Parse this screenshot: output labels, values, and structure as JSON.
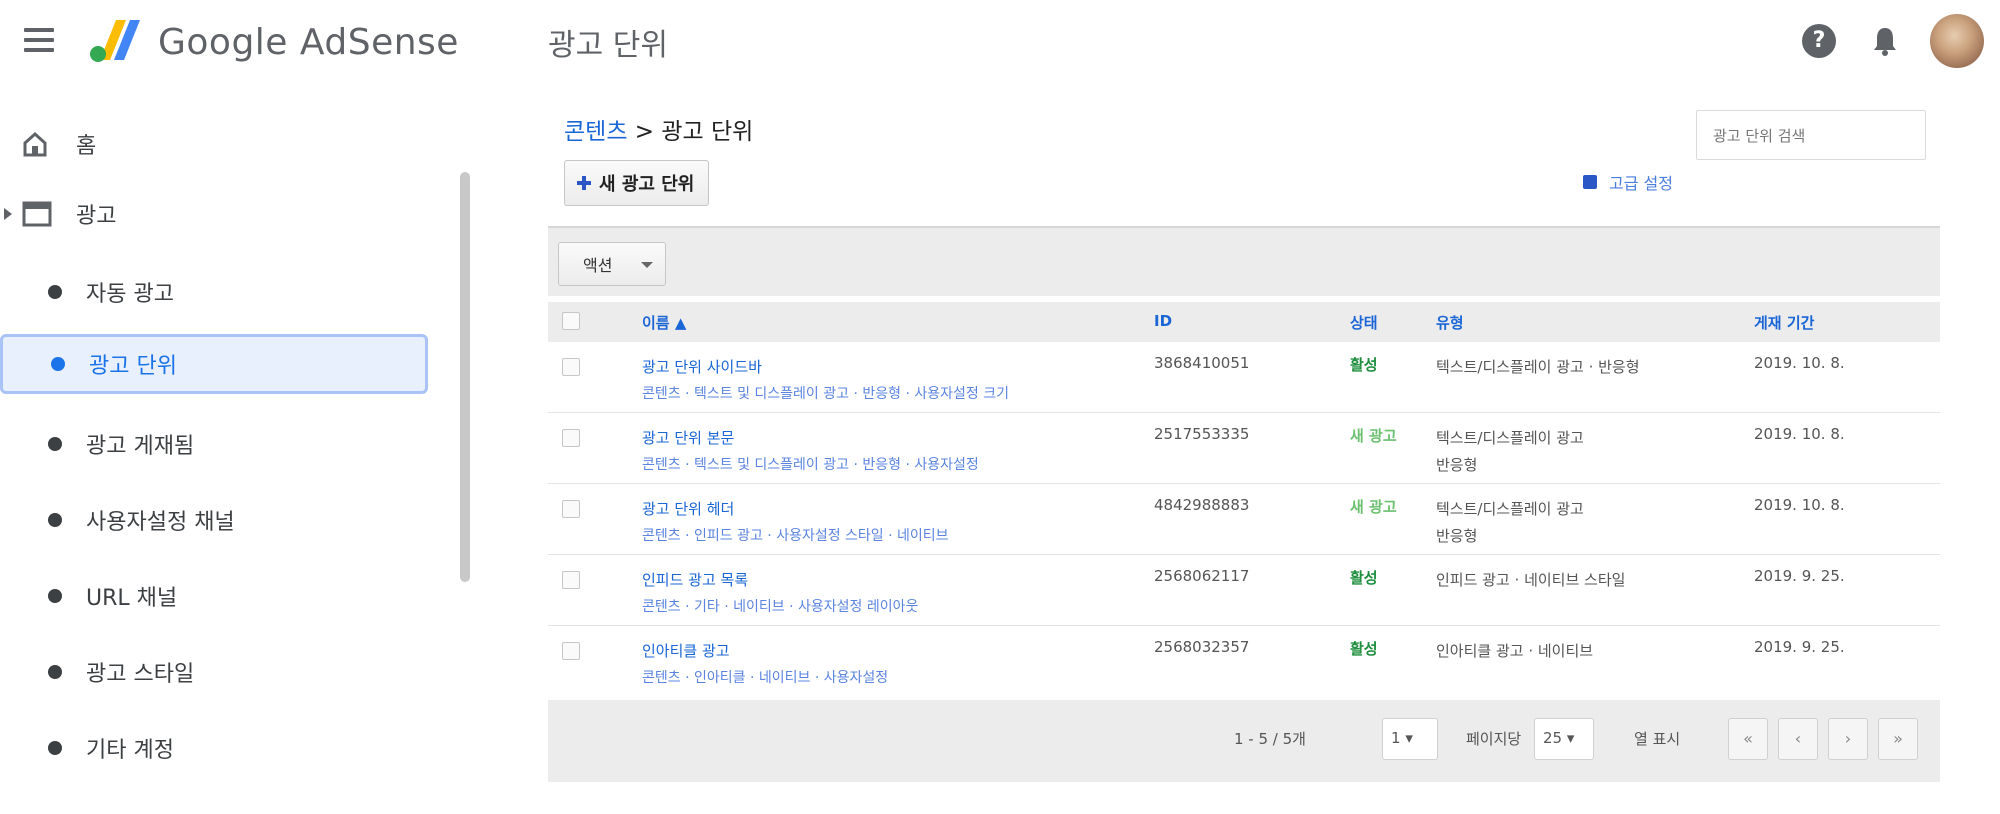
{
  "header": {
    "brand": "Google AdSense",
    "page_title": "광고 단위"
  },
  "sidebar": {
    "items": [
      {
        "label": "홈",
        "icon": "home-icon"
      },
      {
        "label": "광고",
        "icon": "ads-icon"
      },
      {
        "label": "자동 광고"
      },
      {
        "label": "광고 단위"
      },
      {
        "label": "광고 게재됨"
      },
      {
        "label": "사용자설정 채널"
      },
      {
        "label": "URL 채널"
      },
      {
        "label": "광고 스타일"
      },
      {
        "label": "기타 계정"
      }
    ]
  },
  "main": {
    "breadcrumb_link": "콘텐츠",
    "breadcrumb_sep": " > ",
    "breadcrumb_current": "광고 단위",
    "new_button": "새 광고 단위",
    "advanced_link": "고급 설정",
    "search_placeholder": "광고 단위 검색",
    "action_select": "액션"
  },
  "table": {
    "columns": [
      "이름 ▲",
      "ID",
      "상태",
      "유형",
      "게재 기간"
    ],
    "rows": [
      {
        "name": "광고 단위 사이드바",
        "sub": "콘텐츠 · 텍스트 및 디스플레이 광고 · 반응형 · 사용자설정 크기",
        "id": "3868410051",
        "status": "활성",
        "type": "텍스트/디스플레이 광고 · 반응형",
        "type2": "",
        "date": "2019. 10. 8."
      },
      {
        "name": "광고 단위 본문",
        "sub": "콘텐츠 · 텍스트 및 디스플레이 광고 · 반응형 · 사용자설정",
        "id": "2517553335",
        "status": "새 광고",
        "type": "텍스트/디스플레이 광고",
        "type2": "반응형",
        "date": "2019. 10. 8."
      },
      {
        "name": "광고 단위 헤더",
        "sub": "콘텐츠 · 인피드 광고 · 사용자설정 스타일 · 네이티브",
        "id": "4842988883",
        "status": "새 광고",
        "type": "텍스트/디스플레이 광고",
        "type2": "반응형",
        "date": "2019. 10. 8."
      },
      {
        "name": "인피드 광고 목록",
        "sub": "콘텐츠 · 기타 · 네이티브 · 사용자설정 레이아웃",
        "id": "2568062117",
        "status": "활성",
        "type": "인피드 광고 · 네이티브 스타일",
        "type2": "",
        "date": "2019. 9. 25."
      },
      {
        "name": "인아티클 광고",
        "sub": "콘텐츠 · 인아티클 · 네이티브 · 사용자설정",
        "id": "2568032357",
        "status": "활성",
        "type": "인아티클 광고 · 네이티브",
        "type2": "",
        "date": "2019. 9. 25."
      }
    ]
  },
  "footer": {
    "range_text": "1 - 5 / 5개",
    "page_value": "1",
    "rows_label": "페이지당",
    "rows_value": "25",
    "show_label": "열 표시"
  },
  "colors": {
    "accent": "#1a66d6",
    "active_green": "#1e8e3e",
    "new_green": "#6cc070"
  }
}
